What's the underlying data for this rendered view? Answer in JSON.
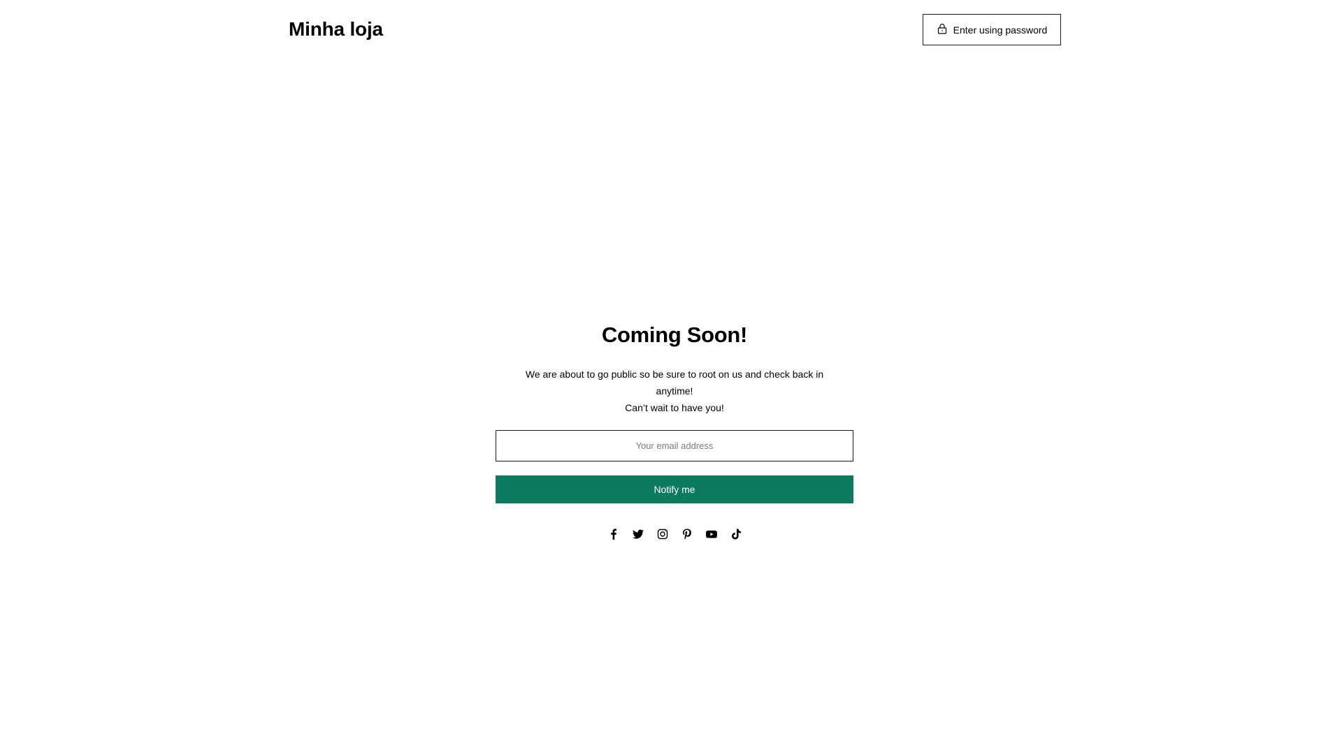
{
  "header": {
    "store_name": "Minha loja",
    "password_button_label": "Enter using password",
    "password_icon": "lock-icon"
  },
  "main": {
    "heading": "Coming Soon!",
    "message_line1": "We are about to go public so be sure to root on us and check back in anytime!",
    "message_line2": "Can’t wait to have you!",
    "email_placeholder": "Your email address",
    "email_value": "",
    "notify_label": "Notify me"
  },
  "social": {
    "icons": [
      "facebook-icon",
      "twitter-icon",
      "instagram-icon",
      "pinterest-icon",
      "youtube-icon",
      "tiktok-icon"
    ]
  },
  "colors": {
    "accent": "#0c7a5e",
    "text": "#000000",
    "background": "#ffffff"
  }
}
